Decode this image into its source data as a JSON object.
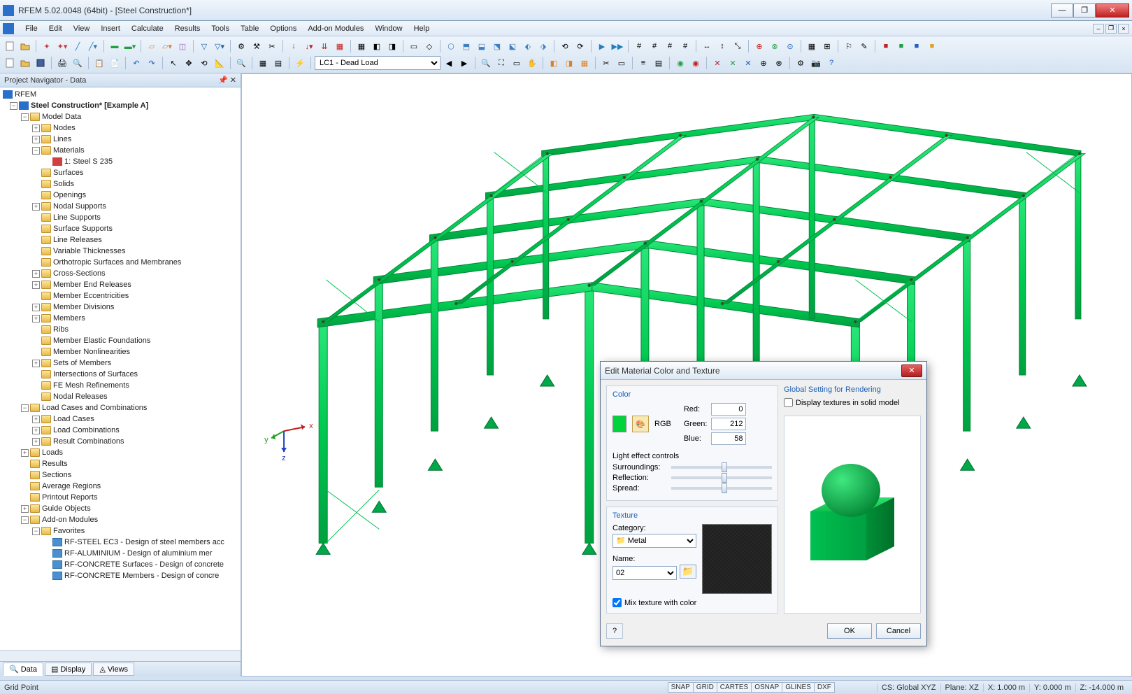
{
  "window": {
    "title": "RFEM 5.02.0048 (64bit) - [Steel Construction*]"
  },
  "menu": [
    "File",
    "Edit",
    "View",
    "Insert",
    "Calculate",
    "Results",
    "Tools",
    "Table",
    "Options",
    "Add-on Modules",
    "Window",
    "Help"
  ],
  "loadcase_combo": "LC1 - Dead Load",
  "navigator": {
    "title": "Project Navigator - Data",
    "root": "RFEM",
    "project": "Steel Construction* [Example A]",
    "model_data": "Model Data",
    "nodes": "Nodes",
    "lines": "Lines",
    "materials": "Materials",
    "material1": "1: Steel S 235",
    "surfaces": "Surfaces",
    "solids": "Solids",
    "openings": "Openings",
    "nodal_supports": "Nodal Supports",
    "line_supports": "Line Supports",
    "surface_supports": "Surface Supports",
    "line_releases": "Line Releases",
    "var_thick": "Variable Thicknesses",
    "ortho": "Orthotropic Surfaces and Membranes",
    "cross": "Cross-Sections",
    "mem_end": "Member End Releases",
    "mem_ecc": "Member Eccentricities",
    "mem_div": "Member Divisions",
    "members": "Members",
    "ribs": "Ribs",
    "mem_elastic": "Member Elastic Foundations",
    "mem_nonlin": "Member Nonlinearities",
    "sets": "Sets of Members",
    "intersect": "Intersections of Surfaces",
    "fe_mesh": "FE Mesh Refinements",
    "nodal_rel": "Nodal Releases",
    "lcc": "Load Cases and Combinations",
    "load_cases": "Load Cases",
    "load_combos": "Load Combinations",
    "result_combos": "Result Combinations",
    "loads": "Loads",
    "results": "Results",
    "sections": "Sections",
    "avg_regions": "Average Regions",
    "printout": "Printout Reports",
    "guide": "Guide Objects",
    "addon": "Add-on Modules",
    "favorites": "Favorites",
    "fav1": "RF-STEEL EC3 - Design of steel members acc",
    "fav2": "RF-ALUMINIUM - Design of aluminium mer",
    "fav3": "RF-CONCRETE Surfaces - Design of concrete",
    "fav4": "RF-CONCRETE Members - Design of concre",
    "tabs": {
      "data": "Data",
      "display": "Display",
      "views": "Views"
    }
  },
  "dialog": {
    "title": "Edit Material Color and Texture",
    "color_title": "Color",
    "rgb_label": "RGB",
    "red_label": "Red:",
    "green_label": "Green:",
    "blue_label": "Blue:",
    "red": "0",
    "green": "212",
    "blue": "58",
    "light_title": "Light effect controls",
    "surround": "Surroundings:",
    "reflect": "Reflection:",
    "spread": "Spread:",
    "texture_title": "Texture",
    "category_label": "Category:",
    "category": "Metal",
    "name_label": "Name:",
    "name": "02",
    "mix": "Mix texture with color",
    "global_title": "Global Setting for Rendering",
    "display_tex": "Display textures in solid model",
    "ok": "OK",
    "cancel": "Cancel"
  },
  "status": {
    "left": "Grid Point",
    "snap": [
      "SNAP",
      "GRID",
      "CARTES",
      "OSNAP",
      "GLINES",
      "DXF"
    ],
    "cs": "CS: Global XYZ",
    "plane": "Plane: XZ",
    "x": "X: 1.000 m",
    "y": "Y: 0.000 m",
    "z": "Z: -14.000 m"
  },
  "viewport": {
    "axis_x": "x",
    "axis_y": "y",
    "axis_z": "z"
  }
}
